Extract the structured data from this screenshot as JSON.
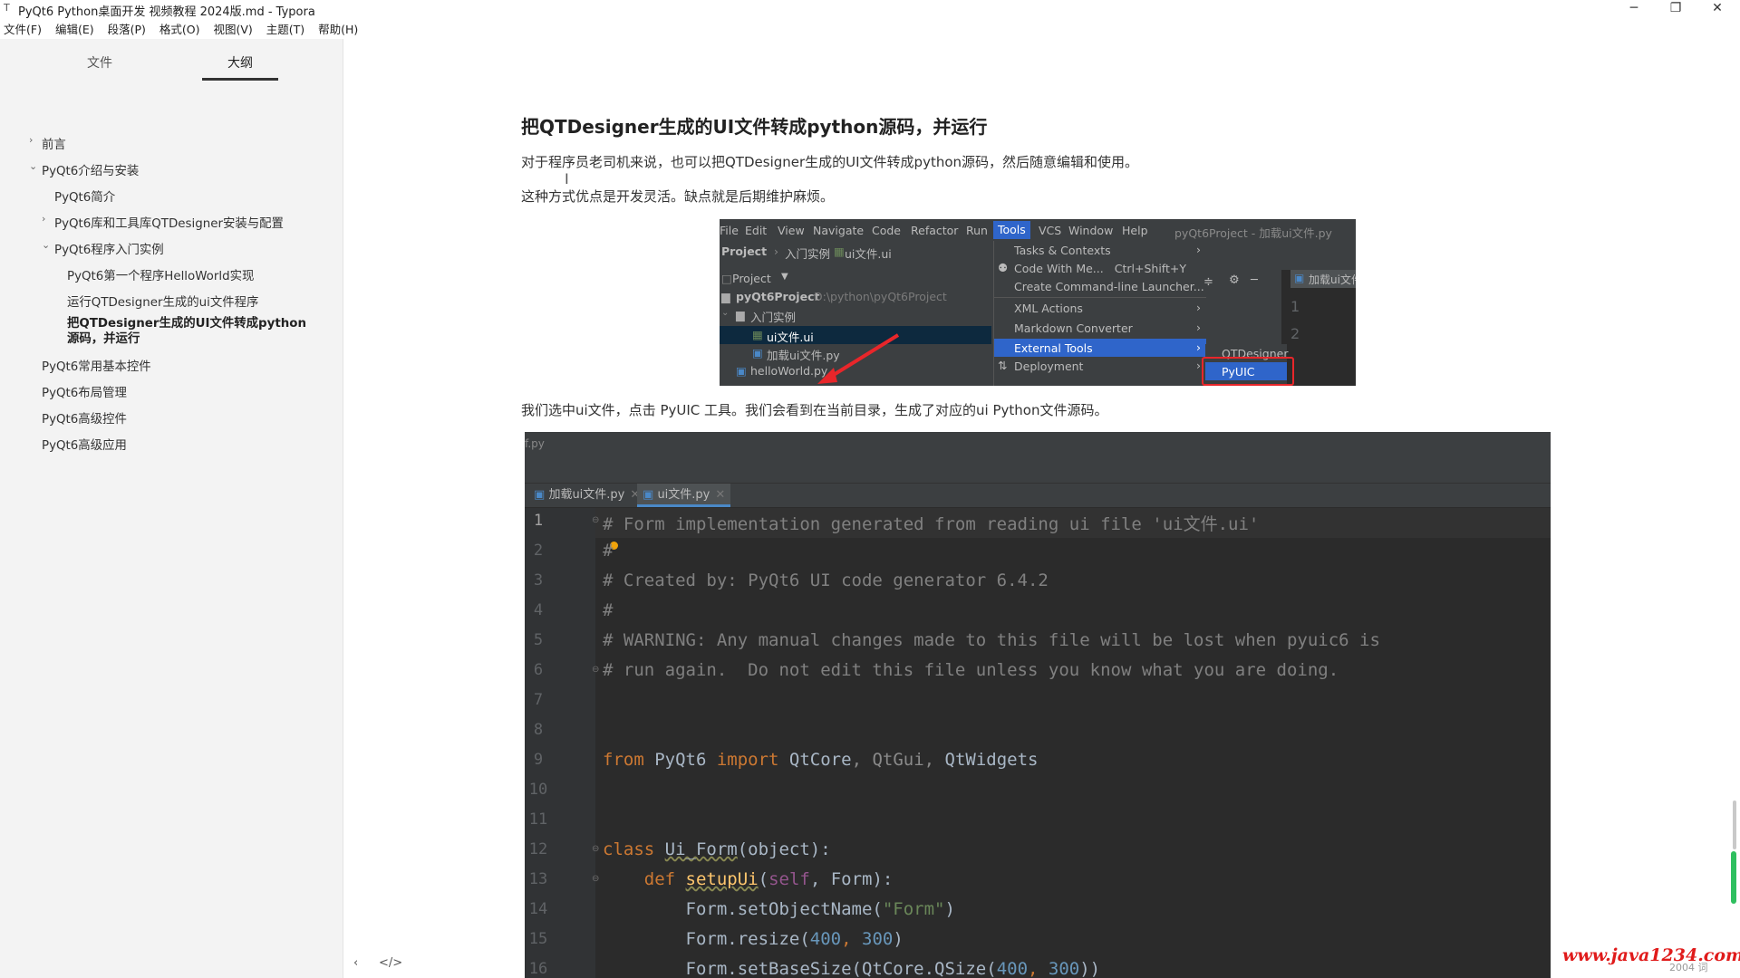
{
  "window": {
    "title": "PyQt6 Python桌面开发 视频教程 2024版.md - Typora",
    "app_icon": "T",
    "minimize": "─",
    "restore": "❐",
    "close": "✕"
  },
  "menubar": [
    "文件(F)",
    "编辑(E)",
    "段落(P)",
    "格式(O)",
    "视图(V)",
    "主题(T)",
    "帮助(H)"
  ],
  "sidebar": {
    "tabs": [
      "文件",
      "大纲"
    ],
    "active_tab": "大纲",
    "outline": [
      {
        "label": "前言",
        "chev": "›"
      },
      {
        "label": "PyQt6介绍与安装",
        "chev": "⌄"
      },
      {
        "label": "PyQt6简介",
        "chev": ""
      },
      {
        "label": "PyQt6库和工具库QTDesigner安装与配置",
        "chev": "›"
      },
      {
        "label": "PyQt6程序入门实例",
        "chev": "⌄"
      },
      {
        "label": "PyQt6第一个程序HelloWorld实现",
        "chev": ""
      },
      {
        "label": "运行QTDesigner生成的ui文件程序",
        "chev": ""
      },
      {
        "label": "把QTDesigner生成的UI文件转成python源码，并运行",
        "chev": ""
      },
      {
        "label": "PyQt6常用基本控件",
        "chev": ""
      },
      {
        "label": "PyQt6布局管理",
        "chev": ""
      },
      {
        "label": "PyQt6高级控件",
        "chev": ""
      },
      {
        "label": "PyQt6高级应用",
        "chev": ""
      }
    ],
    "bottom_left": "‹",
    "bottom_code": "</>"
  },
  "content": {
    "heading": "把QTDesigner生成的UI文件转成python源码，并运行",
    "para1": "对于程序员老司机来说，也可以把QTDesigner生成的UI文件转成python源码，然后随意编辑和使用。",
    "para2": "这种方式优点是开发灵活。缺点就是后期维护麻烦。",
    "para3": "我们选中ui文件，点击 PyUIC 工具。我们会看到在当前目录，生成了对应的ui Python文件源码。"
  },
  "ide": {
    "menu": [
      "File",
      "Edit",
      "View",
      "Navigate",
      "Code",
      "Refactor",
      "Run",
      "Tools",
      "VCS",
      "Window",
      "Help"
    ],
    "selected_menu": "Tools",
    "window_title": "pyQt6Project - 加载ui文件.py",
    "breadcrumbs": [
      "Project",
      "入门实例",
      "ui文件.ui"
    ],
    "project_label": "Project",
    "tree": [
      {
        "label": "pyQt6Project",
        "extra": "D:\\python\\pyQt6Project"
      },
      {
        "label": "入门实例",
        "extra": ""
      },
      {
        "label": "ui文件.ui",
        "extra": ""
      },
      {
        "label": "加载ui文件.py",
        "extra": ""
      },
      {
        "label": "helloWorld.py",
        "extra": ""
      }
    ],
    "dropdown": [
      {
        "label": "Tasks & Contexts",
        "shortcut": "",
        "arrow": "›"
      },
      {
        "label": "Code With Me...",
        "shortcut": "Ctrl+Shift+Y",
        "arrow": ""
      },
      {
        "label": "Create Command-line Launcher...",
        "shortcut": "",
        "arrow": ""
      },
      {
        "label": "XML Actions",
        "shortcut": "",
        "arrow": "›"
      },
      {
        "label": "Markdown Converter",
        "shortcut": "",
        "arrow": "›"
      },
      {
        "label": "External Tools",
        "shortcut": "",
        "arrow": "›"
      },
      {
        "label": "Deployment",
        "shortcut": "",
        "arrow": "›"
      }
    ],
    "submenu": [
      "QTDesigner",
      "PyUIC"
    ],
    "right_tab": "加载ui文件",
    "right_lines": [
      "1",
      "2"
    ]
  },
  "editor": {
    "top_path": "f.py",
    "tabs": [
      "加载ui文件.py",
      "ui文件.py"
    ],
    "active_tab": "ui文件.py",
    "line_numbers": [
      "1",
      "2",
      "3",
      "4",
      "5",
      "6",
      "7",
      "8",
      "9",
      "10",
      "11",
      "12",
      "13",
      "14",
      "15",
      "16"
    ],
    "lines": {
      "l1": "# Form implementation generated from reading ui file 'ui文件.ui'",
      "l2": "#",
      "l3": "# Created by: PyQt6 UI code generator 6.4.2",
      "l4": "#",
      "l5": "# WARNING: Any manual changes made to this file will be lost when pyuic6 is",
      "l6": "# run again.  Do not edit this file unless you know what you are doing.",
      "l9_from": "from",
      "l9_mod": " PyQt6 ",
      "l9_import": "import",
      "l9_rest1": " QtCore",
      "l9_rest2": ", QtGui, ",
      "l9_rest3": "QtWidgets",
      "l12_class": "class",
      "l12_name": "Ui_Form",
      "l12_rest": "(object):",
      "l13_def": "def",
      "l13_fn": "setupUi",
      "l13_open": "(",
      "l13_self": "self",
      "l13_rest": ", Form):",
      "l14_a": "Form.setObjectName(",
      "l14_s": "\"Form\"",
      "l14_b": ")",
      "l15_a": "Form.resize(",
      "l15_n1": "400",
      "l15_c": ", ",
      "l15_n2": "300",
      "l15_b": ")",
      "l16_a": "Form.setBaseSize(QtCore.QSize(",
      "l16_n1": "400",
      "l16_c": ", ",
      "l16_n2": "300",
      "l16_b": "))"
    }
  },
  "watermark": "www.java1234.com",
  "wordcount": "2004 词"
}
